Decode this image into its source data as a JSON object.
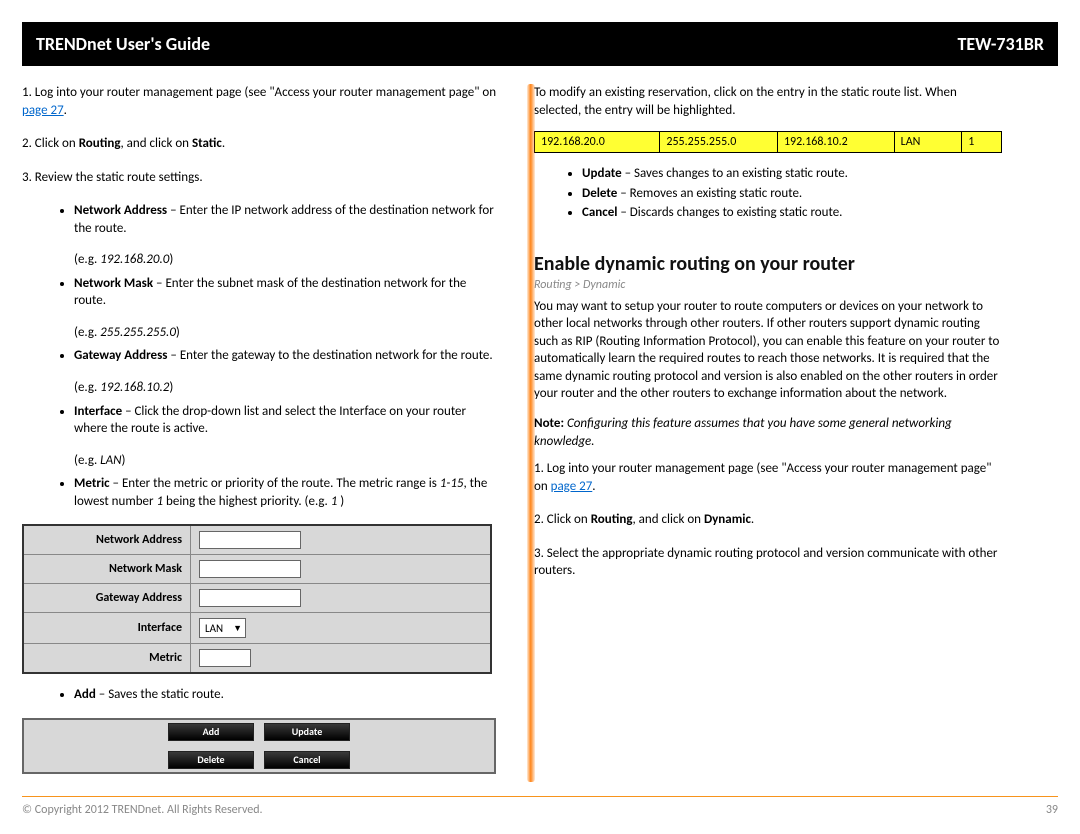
{
  "header": {
    "left": "TRENDnet User's Guide",
    "right": "TEW-731BR"
  },
  "left_col": {
    "step1a": "1. Log into your router management page (see \"Access your router management page\" on ",
    "step1link": "page 27",
    "step1b": ".",
    "step2a": "2. Click on ",
    "step2b": "Routing",
    "step2c": ", and click on ",
    "step2d": "Static",
    "step2e": ".",
    "step3": "3. Review the static route settings.",
    "bullets": [
      {
        "label": "Network Address",
        "desc": " – Enter the IP network address of the destination network for the route.",
        "eg": "(e.g. ",
        "egv": "192.168.20.0",
        "egc": ")"
      },
      {
        "label": "Network Mask",
        "desc": " – Enter the subnet mask of the destination network for the route.",
        "eg": "(e.g. ",
        "egv": "255.255.255.0",
        "egc": ")"
      },
      {
        "label": "Gateway Address",
        "desc": " – Enter the gateway to the destination network for the route.",
        "eg": "(e.g. ",
        "egv": "192.168.10.2",
        "egc": ")"
      }
    ],
    "iface_label": "Interface",
    "iface_desc": " – Click the drop-down list and select the Interface on your router where the route is active.",
    "iface_eg_a": "(e.g. ",
    "iface_eg_v": "LAN",
    "iface_eg_c": ")",
    "metric_label": "Metric",
    "metric_desc_a": " – Enter the metric or priority of the route. The metric range is ",
    "metric_range": "1-15",
    "metric_desc_b": ", the lowest number ",
    "metric_one": "1",
    "metric_desc_c": " being the highest priority. (e.g. ",
    "metric_eg": "1",
    "metric_desc_d": " )",
    "form": {
      "row1": "Network Address",
      "row2": "Network Mask",
      "row3": "Gateway Address",
      "row4": "Interface",
      "row4sel": "LAN",
      "row5": "Metric"
    },
    "add_bullet_label": "Add",
    "add_bullet_desc": " – Saves the static route.",
    "btns": {
      "add": "Add",
      "update": "Update",
      "delete": "Delete",
      "cancel": "Cancel"
    }
  },
  "right_col": {
    "intro": "To modify an existing reservation, click on the entry in the static route list. When selected, the entry will be highlighted.",
    "hilite": [
      "192.168.20.0",
      "255.255.255.0",
      "192.168.10.2",
      "LAN",
      "1"
    ],
    "ops": [
      {
        "label": "Update",
        "desc": " – Saves changes to an existing static route."
      },
      {
        "label": "Delete",
        "desc": " – Removes an existing static route."
      },
      {
        "label": "Cancel",
        "desc": " – Discards changes to existing static route."
      }
    ],
    "section_title": "Enable dynamic routing on your router",
    "breadcrumb": "Routing > Dynamic",
    "para1": "You may want to setup your router to route computers or devices on your network to other local networks through other routers. If other routers support dynamic routing such as RIP (Routing Information Protocol), you can enable this feature on your router to automatically learn the required routes to reach those networks. It is required that the same dynamic routing protocol and version is also enabled on the other routers in order your router and the other routers to exchange information about the network.",
    "note_label": "Note:",
    "note_body": " Configuring this feature assumes that you have some general networking knowledge.",
    "dstep1a": "1. Log into your router management page (see \"Access your router management page\" on ",
    "dstep1link": "page 27",
    "dstep1b": ".",
    "dstep2a": "2. Click on ",
    "dstep2b": "Routing",
    "dstep2c": ", and click on ",
    "dstep2d": "Dynamic",
    "dstep2e": ".",
    "dstep3": "3. Select the appropriate dynamic routing protocol and version communicate with other routers."
  },
  "footer": {
    "copyright": "© Copyright 2012 TRENDnet. All Rights Reserved.",
    "page": "39"
  }
}
